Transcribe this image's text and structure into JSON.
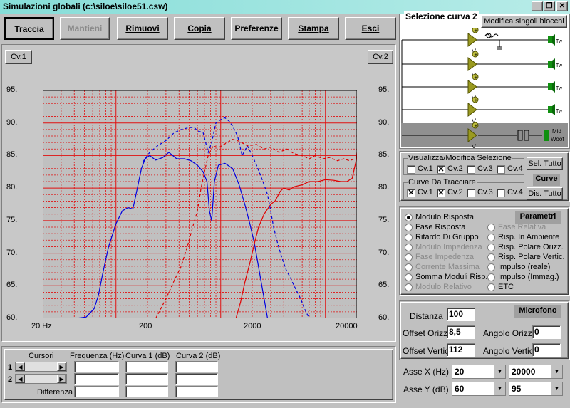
{
  "window": {
    "title": "Simulazioni globali (c:\\siloe\\siloe51.csw)",
    "btn_minimize": "_",
    "btn_restore": "❐",
    "btn_close": "✕"
  },
  "toolbar": {
    "traccia": "Traccia",
    "mantieni": "Mantieni",
    "rimuovi": "Rimuovi",
    "copia": "Copia",
    "preferenze": "Preferenze",
    "stampa": "Stampa",
    "esci": "Esci"
  },
  "graph": {
    "cv1_button": "Cv.1",
    "cv2_button": "Cv.2",
    "y_ticks": [
      "95.",
      "90.",
      "85.",
      "80.",
      "75.",
      "70.",
      "65.",
      "60."
    ],
    "x_ticks": [
      "20 Hz",
      "200",
      "2000",
      "20000"
    ]
  },
  "chart_data": {
    "type": "line",
    "xscale": "log",
    "xlim": [
      20,
      20000
    ],
    "ylim": [
      60,
      95
    ],
    "grid": true,
    "series": [
      {
        "color": "#0000e0",
        "dash": "solid",
        "points": [
          [
            42,
            60
          ],
          [
            52,
            60.2
          ],
          [
            62,
            61.5
          ],
          [
            68,
            63.5
          ],
          [
            75,
            67
          ],
          [
            85,
            71
          ],
          [
            100,
            74.5
          ],
          [
            115,
            76.5
          ],
          [
            130,
            77
          ],
          [
            145,
            76.8
          ],
          [
            160,
            80
          ],
          [
            175,
            83
          ],
          [
            190,
            84.5
          ],
          [
            210,
            85
          ],
          [
            240,
            84.3
          ],
          [
            280,
            84.7
          ],
          [
            320,
            85.5
          ],
          [
            380,
            84.5
          ],
          [
            450,
            84.5
          ],
          [
            520,
            84.2
          ],
          [
            600,
            83.5
          ],
          [
            680,
            82.5
          ],
          [
            740,
            81
          ],
          [
            780,
            76.5
          ],
          [
            820,
            75
          ],
          [
            870,
            81
          ],
          [
            950,
            83.5
          ],
          [
            1100,
            83.8
          ],
          [
            1300,
            83
          ],
          [
            1500,
            80.5
          ],
          [
            1700,
            77.5
          ],
          [
            1900,
            74.5
          ],
          [
            2100,
            71.5
          ],
          [
            2350,
            67
          ],
          [
            2600,
            63
          ],
          [
            2800,
            60
          ]
        ]
      },
      {
        "color": "#0000e0",
        "dash": "dash",
        "points": [
          [
            180,
            84
          ],
          [
            210,
            85.5
          ],
          [
            250,
            86.5
          ],
          [
            300,
            87.3
          ],
          [
            360,
            88.5
          ],
          [
            420,
            89
          ],
          [
            500,
            89.3
          ],
          [
            560,
            89.3
          ],
          [
            600,
            88.8
          ],
          [
            680,
            88.5
          ],
          [
            760,
            85.5
          ],
          [
            820,
            87
          ],
          [
            900,
            90
          ],
          [
            1000,
            90.5
          ],
          [
            1100,
            90.8
          ],
          [
            1200,
            90.3
          ],
          [
            1300,
            89.5
          ],
          [
            1450,
            88
          ],
          [
            1600,
            85
          ],
          [
            1800,
            86.5
          ],
          [
            2000,
            85
          ],
          [
            2200,
            83.5
          ],
          [
            2400,
            82
          ],
          [
            2600,
            80.5
          ],
          [
            2800,
            79
          ],
          [
            3000,
            76.5
          ],
          [
            3200,
            74
          ],
          [
            3500,
            71.5
          ],
          [
            3800,
            69.5
          ],
          [
            4200,
            67.5
          ],
          [
            4700,
            66
          ],
          [
            5200,
            64.5
          ],
          [
            5800,
            63
          ],
          [
            6300,
            61.5
          ],
          [
            6900,
            60.2
          ]
        ]
      },
      {
        "color": "#e00000",
        "dash": "solid",
        "points": [
          [
            1400,
            60
          ],
          [
            1550,
            62.5
          ],
          [
            1700,
            65.5
          ],
          [
            1900,
            68.5
          ],
          [
            2100,
            71.5
          ],
          [
            2300,
            74
          ],
          [
            2600,
            76
          ],
          [
            3000,
            77.5
          ],
          [
            3300,
            78
          ],
          [
            3700,
            79.5
          ],
          [
            4000,
            80
          ],
          [
            4500,
            79.7
          ],
          [
            5000,
            80.2
          ],
          [
            6000,
            80.5
          ],
          [
            7000,
            81
          ],
          [
            8500,
            81
          ],
          [
            10000,
            81.3
          ],
          [
            12000,
            81.2
          ],
          [
            14000,
            81
          ],
          [
            16000,
            81
          ],
          [
            18000,
            81.5
          ],
          [
            19500,
            84
          ],
          [
            20000,
            85.5
          ]
        ]
      },
      {
        "color": "#e00000",
        "dash": "dash",
        "points": [
          [
            240,
            60
          ],
          [
            300,
            63
          ],
          [
            360,
            65.8
          ],
          [
            420,
            68
          ],
          [
            480,
            71
          ],
          [
            540,
            74
          ],
          [
            600,
            76.5
          ],
          [
            650,
            80
          ],
          [
            700,
            82.5
          ],
          [
            760,
            85
          ],
          [
            850,
            86.5
          ],
          [
            950,
            86.2
          ],
          [
            1100,
            86.8
          ],
          [
            1300,
            87.5
          ],
          [
            1500,
            87.2
          ],
          [
            1800,
            86.5
          ],
          [
            2200,
            86.7
          ],
          [
            2600,
            86
          ],
          [
            3000,
            86.3
          ],
          [
            3600,
            85.5
          ],
          [
            4300,
            86
          ],
          [
            5000,
            85.3
          ],
          [
            6000,
            85
          ],
          [
            7000,
            84.5
          ],
          [
            8000,
            85
          ],
          [
            9500,
            84.5
          ],
          [
            11000,
            84.7
          ],
          [
            13000,
            84.2
          ],
          [
            15000,
            84.5
          ],
          [
            17000,
            84.2
          ],
          [
            19000,
            84.5
          ],
          [
            20000,
            84.5
          ]
        ]
      }
    ]
  },
  "selection": {
    "title": "Selezione curva 2",
    "modifica_button": "Modifica singoli blocchi",
    "bottom_labels": [
      "Mid",
      "Woof"
    ]
  },
  "visualizza": {
    "title": "Visualizza/Modifica Selezione",
    "sel_tutto": "Sel. Tutto",
    "items": [
      {
        "label": "Cv.1",
        "checked": false
      },
      {
        "label": "Cv.2",
        "checked": true
      },
      {
        "label": "Cv.3",
        "checked": false
      },
      {
        "label": "Cv.4",
        "checked": false
      }
    ],
    "curve_tag": "Curve"
  },
  "tracciare": {
    "title": "Curve Da Tracciare",
    "dis_tutto": "Dis. Tutto",
    "items": [
      {
        "label": "Cv.1",
        "checked": true
      },
      {
        "label": "Cv.2",
        "checked": true
      },
      {
        "label": "Cv.3",
        "checked": false
      },
      {
        "label": "Cv.4",
        "checked": false
      }
    ]
  },
  "parametri": {
    "tag": "Parametri",
    "left": [
      {
        "label": "Modulo Risposta",
        "selected": true,
        "enabled": true
      },
      {
        "label": "Fase Risposta",
        "selected": false,
        "enabled": true
      },
      {
        "label": "Ritardo Di Gruppo",
        "selected": false,
        "enabled": true
      },
      {
        "label": "Modulo Impedenza",
        "selected": false,
        "enabled": false
      },
      {
        "label": "Fase Impedenza",
        "selected": false,
        "enabled": false
      },
      {
        "label": "Corrente Massima",
        "selected": false,
        "enabled": false
      },
      {
        "label": "Somma Moduli Risp.",
        "selected": false,
        "enabled": true
      },
      {
        "label": "Modulo Relativo",
        "selected": false,
        "enabled": false
      }
    ],
    "right": [
      {
        "label": "Fase Relativa",
        "selected": false,
        "enabled": false
      },
      {
        "label": "Risp. In Ambiente",
        "selected": false,
        "enabled": true
      },
      {
        "label": "Risp. Polare Orizz.",
        "selected": false,
        "enabled": true
      },
      {
        "label": "Risp. Polare Vertic.",
        "selected": false,
        "enabled": true
      },
      {
        "label": "Impulso (reale)",
        "selected": false,
        "enabled": true
      },
      {
        "label": "Impulso (Immag.)",
        "selected": false,
        "enabled": true
      },
      {
        "label": "ETC",
        "selected": false,
        "enabled": true
      }
    ]
  },
  "microfono": {
    "tag": "Microfono",
    "distanza_label": "Distanza",
    "distanza": "100",
    "offset_orizz_label": "Offset Orizz.",
    "offset_orizz": "8,5",
    "offset_vertic_label": "Offset Vertic.",
    "offset_vertic": "112",
    "angolo_orizz_label": "Angolo Orizz.",
    "angolo_orizz": "0",
    "angolo_vertic_label": "Angolo Vertic.",
    "angolo_vertic": "0"
  },
  "assi": {
    "x_label": "Asse X  (Hz)",
    "x_min": "20",
    "x_max": "20000",
    "y_label": "Asse Y  (dB)",
    "y_min": "60",
    "y_max": "95"
  },
  "cursori": {
    "title": "Cursori",
    "col_freq": "Frequenza (Hz)",
    "col_curva1": "Curva 1 (dB)",
    "col_curva2": "Curva 2 (dB)",
    "row1": "1",
    "row2": "2",
    "differenza": "Differenza"
  }
}
